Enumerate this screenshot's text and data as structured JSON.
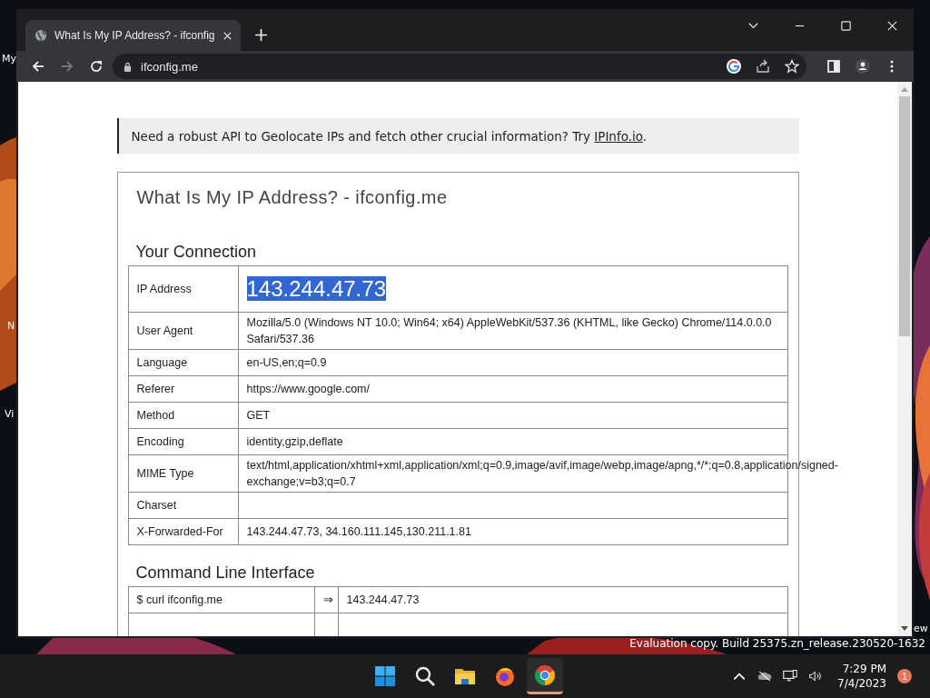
{
  "desktop": {
    "labels": [
      "My",
      "N",
      "Vi",
      "ew"
    ],
    "watermark": "Evaluation copy. Build 25375.zn_release.230520-1632"
  },
  "browser": {
    "tabs": [
      {
        "title": "What Is My IP Address? - ifconfig",
        "selected": true
      }
    ],
    "forward_disabled": true,
    "address": "ifconfig.me"
  },
  "page": {
    "notice": {
      "text": "Need a robust API to Geolocate IPs and fetch other crucial information? Try ",
      "link": "IPInfo.io",
      "after": "."
    },
    "title": "What Is My IP Address? - ifconfig.me",
    "connection": {
      "heading": "Your Connection",
      "value_selected": true,
      "rows": [
        {
          "label": "IP Address",
          "value": "143.244.47.73",
          "kind": "big"
        },
        {
          "label": "User Agent",
          "value": "Mozilla/5.0 (Windows NT 10.0; Win64; x64) AppleWebKit/537.36 (KHTML, like Gecko) Chrome/114.0.0.0 Safari/537.36",
          "kind": "text"
        },
        {
          "label": "Language",
          "value": "en-US,en;q=0.9",
          "kind": "text"
        },
        {
          "label": "Referer",
          "value": "https://www.google.com/",
          "kind": "text"
        },
        {
          "label": "Method",
          "value": "GET",
          "kind": "text"
        },
        {
          "label": "Encoding",
          "value": "identity,gzip,deflate",
          "kind": "text"
        },
        {
          "label": "MIME Type",
          "value": "text/html,application/xhtml+xml,application/xml;q=0.9,image/avif,image/webp,image/apng,*/*;q=0.8,application/signed-exchange;v=b3;q=0.7",
          "kind": "text"
        },
        {
          "label": "Charset",
          "kind": "text"
        },
        {
          "label": "X-Forwarded-For",
          "value": "143.244.47.73, 34.160.111.145,130.211.1.81",
          "kind": "text"
        }
      ]
    },
    "cli": {
      "heading": "Command Line Interface",
      "rows": [
        {
          "command": "$ curl ifconfig.me",
          "arrow": "⇒",
          "result": "143.244.47.73"
        }
      ]
    }
  },
  "taskbar": {
    "apps": [
      {
        "kind": "start",
        "selected": false
      },
      {
        "kind": "search",
        "selected": false
      },
      {
        "kind": "folder",
        "selected": false
      },
      {
        "kind": "firefox",
        "selected": false
      },
      {
        "kind": "chrome",
        "selected": true
      }
    ],
    "time": "7:29 PM",
    "date": "7/4/2023",
    "notifications": "1"
  }
}
